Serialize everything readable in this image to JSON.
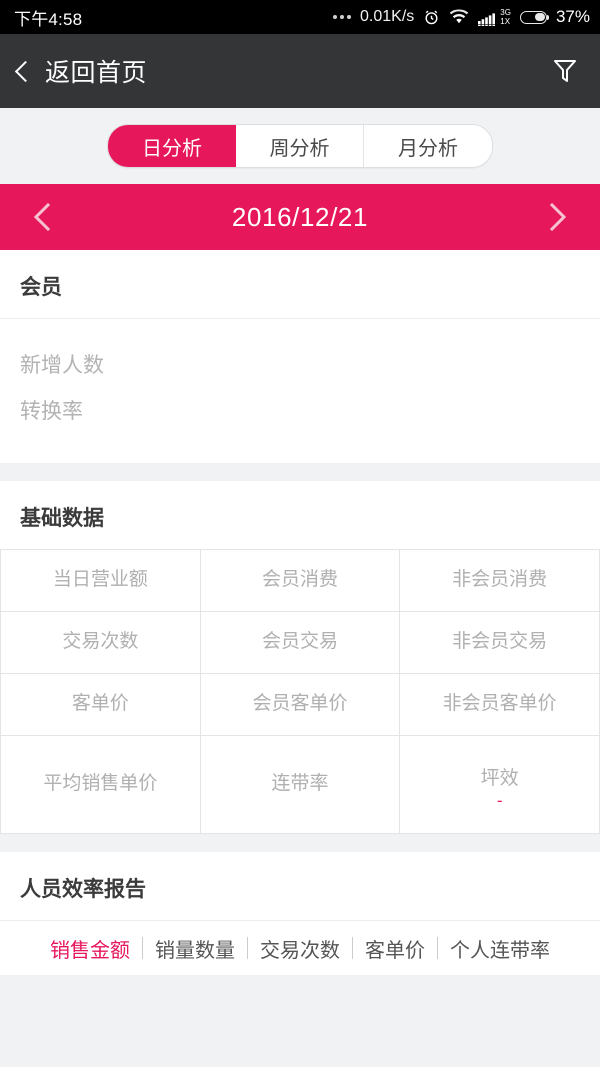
{
  "status_bar": {
    "time": "下午4:58",
    "net_speed": "0.01K/s",
    "network_generation": "3G",
    "network_mode": "1X",
    "battery_percent": "37%"
  },
  "nav": {
    "back_label": "返回首页",
    "filter_icon": "filter-funnel-icon",
    "back_icon": "chevron-left-icon"
  },
  "segmented": {
    "items": [
      {
        "label": "日分析",
        "active": true
      },
      {
        "label": "周分析",
        "active": false
      },
      {
        "label": "月分析",
        "active": false
      }
    ]
  },
  "date_bar": {
    "prev_icon": "chevron-left-icon",
    "next_icon": "chevron-right-icon",
    "date": "2016/12/21"
  },
  "member_section": {
    "title": "会员",
    "rows": [
      {
        "label": "新增人数",
        "value": ""
      },
      {
        "label": "转换率",
        "value": ""
      }
    ]
  },
  "basic_data": {
    "title": "基础数据",
    "cells": [
      {
        "label": "当日营业额",
        "value": ""
      },
      {
        "label": "会员消费",
        "value": ""
      },
      {
        "label": "非会员消费",
        "value": ""
      },
      {
        "label": "交易次数",
        "value": ""
      },
      {
        "label": "会员交易",
        "value": ""
      },
      {
        "label": "非会员交易",
        "value": ""
      },
      {
        "label": "客单价",
        "value": ""
      },
      {
        "label": "会员客单价",
        "value": ""
      },
      {
        "label": "非会员客单价",
        "value": ""
      },
      {
        "label": "平均销售单价",
        "value": ""
      },
      {
        "label": "连带率",
        "value": ""
      },
      {
        "label": "坪效",
        "value": "-"
      }
    ]
  },
  "staff_report": {
    "title": "人员效率报告",
    "tabs": [
      {
        "label": "销售金额",
        "active": true
      },
      {
        "label": "销量数量",
        "active": false
      },
      {
        "label": "交易次数",
        "active": false
      },
      {
        "label": "客单价",
        "active": false
      },
      {
        "label": "个人连带率",
        "active": false
      }
    ]
  },
  "colors": {
    "accent": "#e6175b",
    "nav_bg": "#333537",
    "page_bg": "#f0f2f3"
  }
}
